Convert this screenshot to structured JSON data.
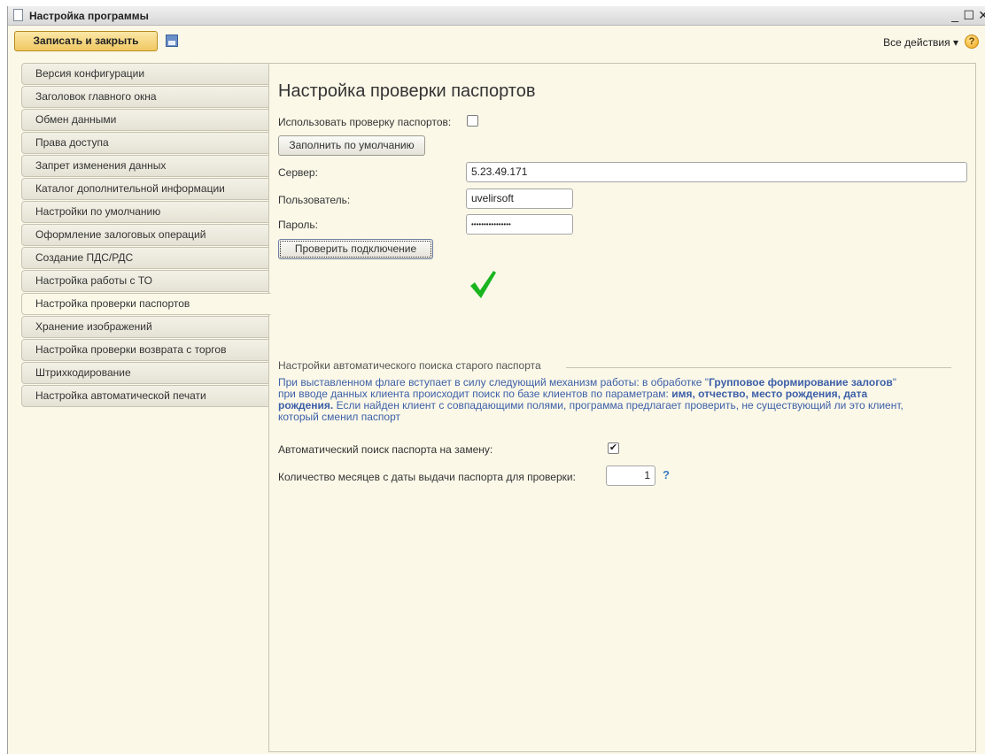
{
  "window": {
    "title": "Настройка программы",
    "controls": {
      "minimize": "_",
      "maximize": "☐",
      "close": "✕"
    }
  },
  "toolbar": {
    "save_close_label": "Записать и закрыть",
    "save_icon": "floppy-disk-icon",
    "all_actions_label": "Все действия ▾",
    "help_label": "?"
  },
  "sidebar": {
    "items": [
      {
        "label": "Версия конфигурации"
      },
      {
        "label": "Заголовок главного окна"
      },
      {
        "label": "Обмен данными"
      },
      {
        "label": "Права доступа"
      },
      {
        "label": "Запрет изменения данных"
      },
      {
        "label": "Каталог дополнительной информации"
      },
      {
        "label": "Настройки по умолчанию"
      },
      {
        "label": "Оформление залоговых операций"
      },
      {
        "label": "Создание ПДС/РДС"
      },
      {
        "label": "Настройка работы с ТО"
      },
      {
        "label": "Настройка проверки паспортов",
        "active": true
      },
      {
        "label": "Хранение изображений"
      },
      {
        "label": "Настройка проверки возврата с торгов"
      },
      {
        "label": "Штрихкодирование"
      },
      {
        "label": "Настройка автоматической печати"
      }
    ]
  },
  "main": {
    "title": "Настройка проверки паспортов",
    "use_check_label": "Использовать проверку паспортов:",
    "use_check_checked": false,
    "fill_default_button": "Заполнить по умолчанию",
    "server_label": "Сервер:",
    "server_value": "5.23.49.171",
    "user_label": "Пользователь:",
    "user_value": "uvelirsoft",
    "password_label": "Пароль:",
    "password_value": "••••••••••••••••",
    "check_connection_button": "Проверить подключение",
    "status_icon": "green-checkmark-icon",
    "status_color": "#19b51e",
    "auto_section": {
      "title": "Настройки автоматического поиска старого паспорта",
      "info_parts": [
        "При выставленном флаге вступает в силу следующий механизм работы: в обработке \"",
        "Групповое формирование залогов",
        "\" при вводе данных клиента происходит поиск по базе клиентов по параметрам: ",
        "имя, отчество, место рождения, дата рождения.",
        " Если найден клиент с совпадающими полями, программа предлагает проверить, не существующий ли это клиент, который сменил паспорт"
      ],
      "auto_search_label": "Автоматический поиск паспорта на замену:",
      "auto_search_checked": true,
      "months_label": "Количество месяцев с даты выдачи паспорта для проверки:",
      "months_value": "1",
      "months_help": "?"
    }
  },
  "colors": {
    "background": "#fbf8e8",
    "primary_button": "#f1c862",
    "info_text": "#3c5fa8"
  }
}
